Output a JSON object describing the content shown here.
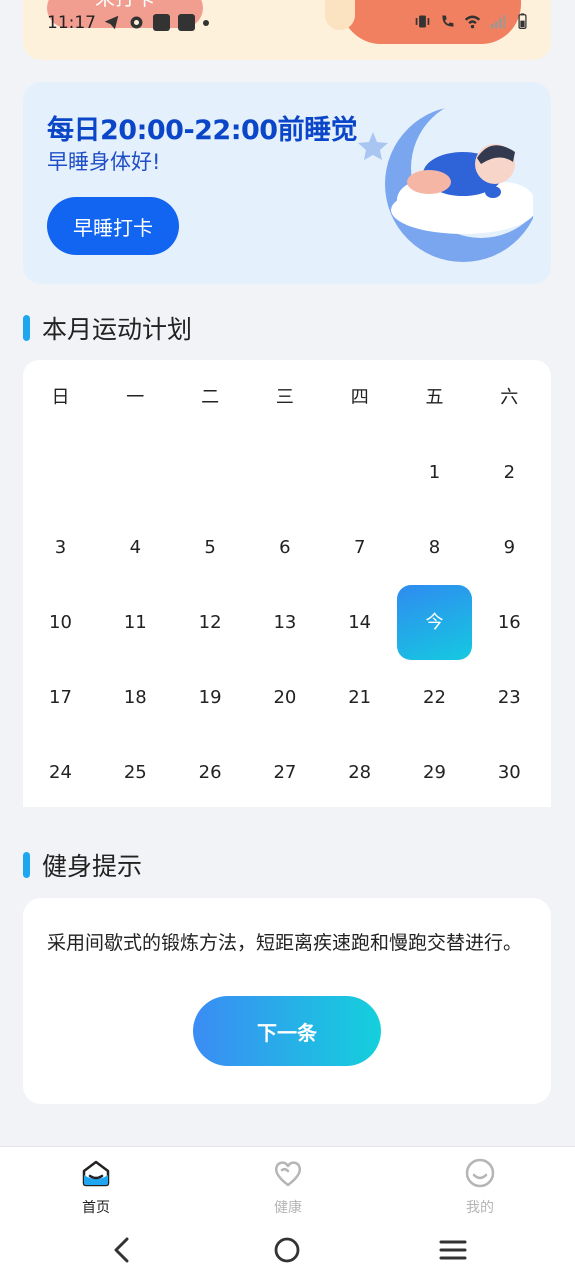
{
  "status_bar": {
    "time": "11:17"
  },
  "top_card": {
    "label": "未打卡"
  },
  "sleep_card": {
    "title": "每日20:00-22:00前睡觉",
    "subtitle": "早睡身体好!",
    "button_label": "早睡打卡"
  },
  "plan_section": {
    "title": "本月运动计划"
  },
  "calendar": {
    "weekdays": [
      "日",
      "一",
      "二",
      "三",
      "四",
      "五",
      "六"
    ],
    "today_label": "今",
    "days": [
      "1",
      "2",
      "3",
      "4",
      "5",
      "6",
      "7",
      "8",
      "9",
      "10",
      "11",
      "12",
      "13",
      "14",
      "16",
      "17",
      "18",
      "19",
      "20",
      "21",
      "22",
      "23",
      "24",
      "25",
      "26",
      "27",
      "28",
      "29",
      "30"
    ]
  },
  "tips_section": {
    "title": "健身提示"
  },
  "tips_card": {
    "text": "采用间歇式的锻炼方法，短距离疾速跑和慢跑交替进行。",
    "button_label": "下一条"
  },
  "bottom_nav": {
    "items": [
      {
        "label": "首页",
        "icon": "home-icon",
        "active": true
      },
      {
        "label": "健康",
        "icon": "heart-icon",
        "active": false
      },
      {
        "label": "我的",
        "icon": "smile-icon",
        "active": false
      }
    ]
  },
  "colors": {
    "accent": "#1265f0",
    "title_blue": "#0b46c9",
    "gradient_start": "#2f8bf0",
    "gradient_end": "#15c9e0"
  }
}
